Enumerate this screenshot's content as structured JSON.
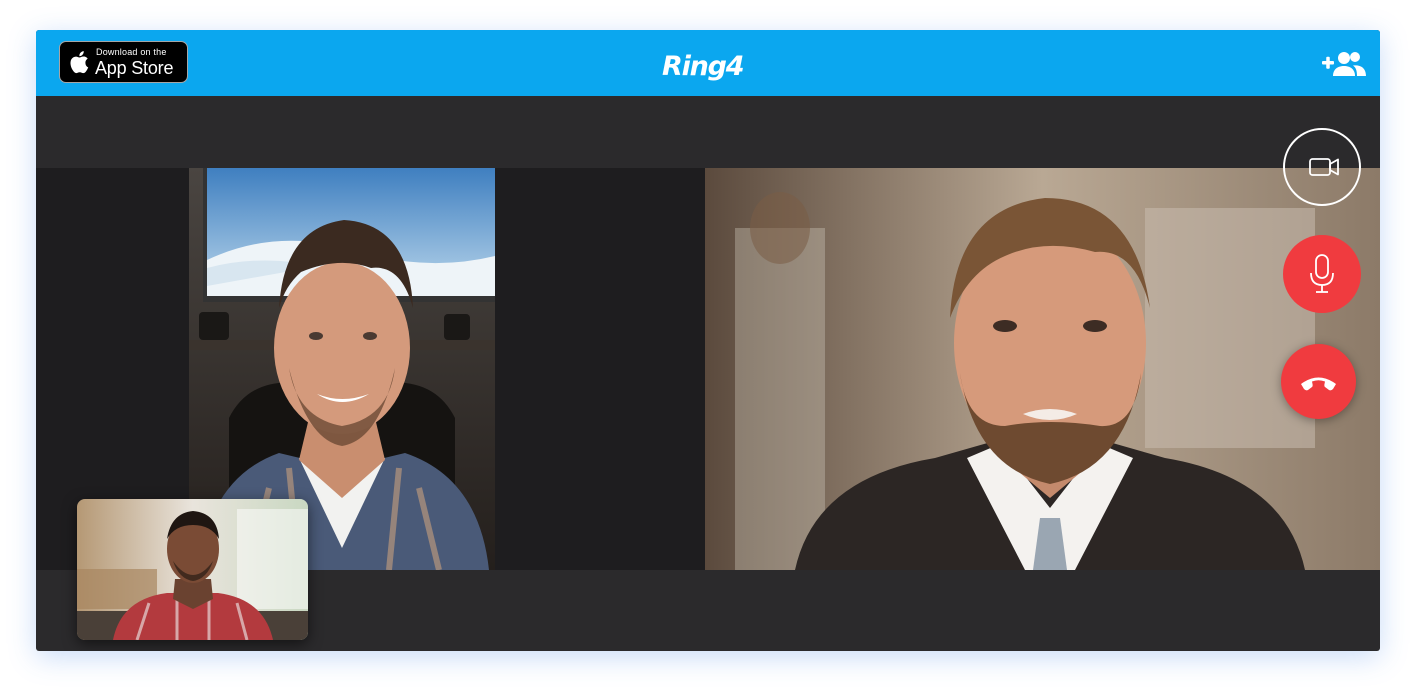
{
  "header": {
    "app_store_badge": {
      "line1": "Download on the",
      "line2": "App Store"
    },
    "logo_text": "Ring4",
    "add_participant_icon": "add-people-icon",
    "color": "#0ba7ef"
  },
  "call": {
    "participants": [
      {
        "id": "participant-1",
        "description": "remote-video-feed"
      },
      {
        "id": "participant-2",
        "description": "remote-video-feed"
      }
    ],
    "self_view": "local-video-preview"
  },
  "controls": {
    "video_icon": "video-camera-icon",
    "mic_icon": "microphone-icon",
    "hangup_icon": "phone-hangup-icon",
    "danger_color": "#f03b3f"
  }
}
